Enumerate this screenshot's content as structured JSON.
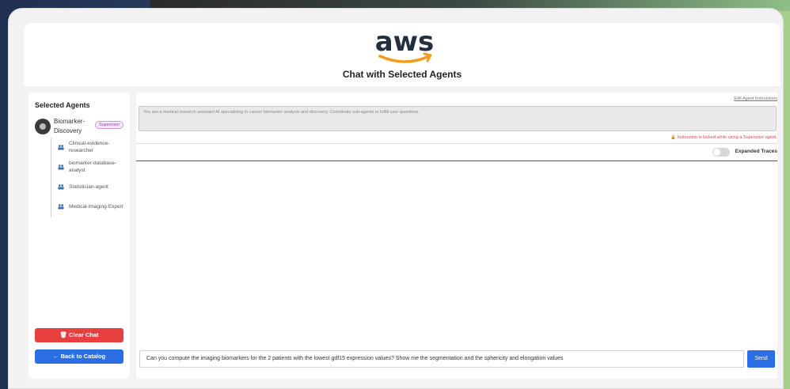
{
  "header": {
    "logo_text": "aws",
    "title": "Chat with Selected Agents"
  },
  "sidebar": {
    "title": "Selected Agents",
    "supervisor": {
      "name": "Biomarker-Discovery",
      "badge": "Supervisor",
      "icon": "agent-avatar-icon"
    },
    "sub_agents": [
      {
        "name": "Clinical-evidence-researcher",
        "icon": "people-icon"
      },
      {
        "name": "biomarker-database-analyst",
        "icon": "people-icon"
      },
      {
        "name": "Statistician-agent",
        "icon": "people-icon"
      },
      {
        "name": "Medical-Imaging-Expert",
        "icon": "people-icon"
      }
    ],
    "clear_chat_label": "Clear Chat",
    "back_label": "← Back to Catalog"
  },
  "main": {
    "edit_link": "Edit Agent Instructions",
    "instructions": "You are a medical research assistant AI specializing in cancer biomarker analysis and discovery. Coordinate sub-agents to fulfill user questions.",
    "lock_note": "🔒 Instruction is locked while using a Supervisor agent.",
    "expanded_traces_label": "Expanded Traces",
    "expanded_traces_on": false,
    "input_value": "Can you compute the imaging biomarkers for the 2 patients with the lowest gdf15 expression values? Show me the segmentation and the sphericity and elongation values",
    "send_label": "Send"
  },
  "colors": {
    "danger": "#e7403f",
    "primary": "#2c6ee6",
    "badge_purple": "#8a4aa3",
    "aws_orange": "#f29d1e"
  }
}
